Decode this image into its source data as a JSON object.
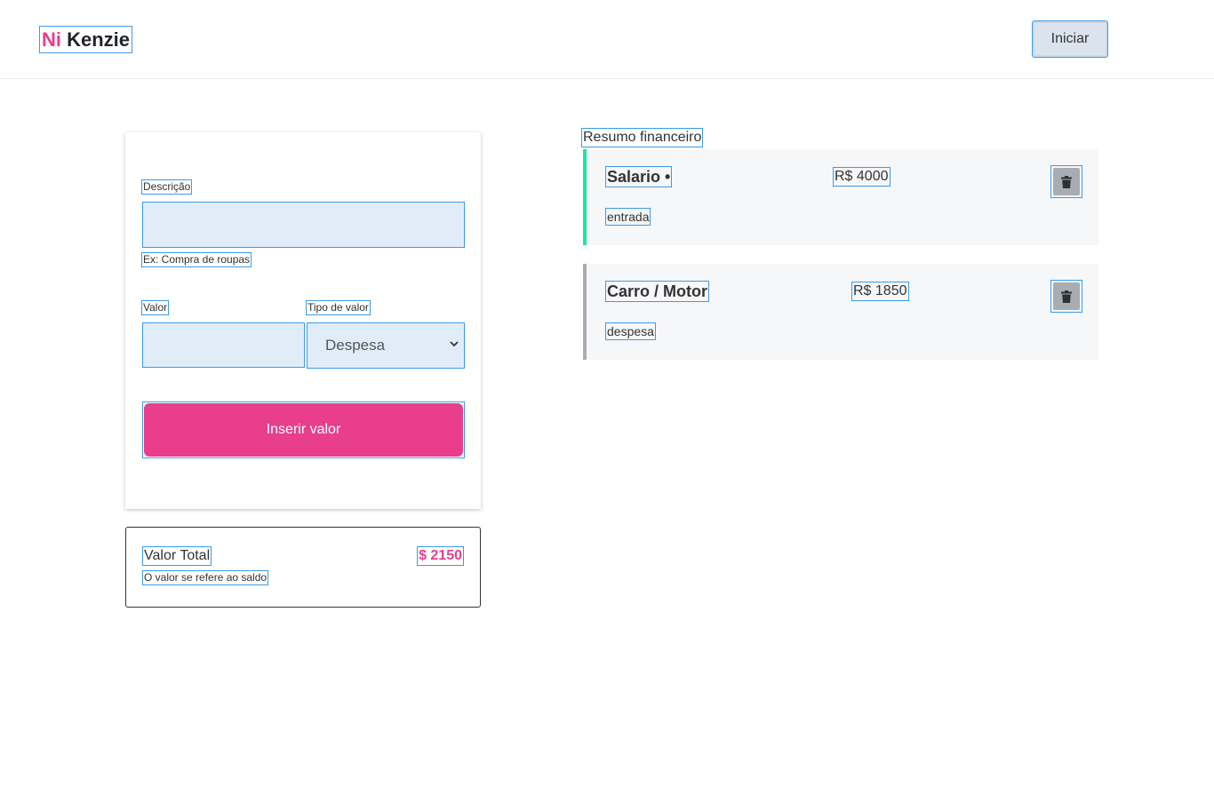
{
  "header": {
    "logo_primary": "Ni",
    "logo_secondary": "Kenzie",
    "start_button": "Iniciar"
  },
  "form": {
    "description_label": "Descrição",
    "description_value": "",
    "description_hint": "Ex: Compra de roupas",
    "value_label": "Valor",
    "value_value": "",
    "type_label": "Tipo de valor",
    "type_selected": "Despesa",
    "submit_label": "Inserir valor"
  },
  "total": {
    "label": "Valor Total",
    "value": "$ 2150",
    "note": "O valor se refere ao saldo"
  },
  "summary": {
    "title": "Resumo financeiro",
    "entries": [
      {
        "name": "Salario •",
        "amount": "R$ 4000",
        "kind": "entrada",
        "accent": "#1de5a2"
      },
      {
        "name": "Carro / Motor",
        "amount": "R$ 1850",
        "kind": "despesa",
        "accent": "#a8abaf"
      }
    ]
  },
  "icons": {
    "delete": "trash-icon",
    "dropdown": "chevron-down-icon"
  },
  "colors": {
    "brand": "#e83e8c",
    "income": "#1de5a2",
    "expense": "#a8abaf"
  }
}
